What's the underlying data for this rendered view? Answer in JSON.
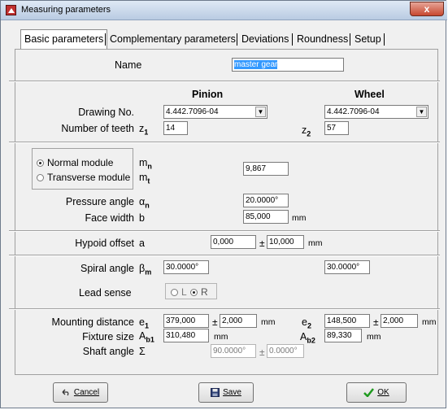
{
  "window": {
    "title": "Measuring parameters",
    "close_label": "x"
  },
  "tabs": [
    {
      "label": "Basic parameters",
      "active": true
    },
    {
      "label": "Complementary parameters",
      "active": false
    },
    {
      "label": "Deviations",
      "active": false
    },
    {
      "label": "Roundness",
      "active": false
    },
    {
      "label": "Setup",
      "active": false
    }
  ],
  "name": {
    "label": "Name",
    "value": "master gear"
  },
  "columns": {
    "pinion": "Pinion",
    "wheel": "Wheel"
  },
  "drawing": {
    "label": "Drawing No.",
    "pinion": "4.442.7096-04",
    "wheel": "4.442.7096-04"
  },
  "teeth": {
    "label": "Number of teeth",
    "sym_pinion": "z",
    "sub_pinion": "1",
    "pinion": "14",
    "sym_wheel": "z",
    "sub_wheel": "2",
    "wheel": "57"
  },
  "module": {
    "normal_label": "Normal module",
    "transverse_label": "Transverse module",
    "selected": "normal",
    "sym_normal": "m",
    "sub_normal": "n",
    "sym_trans": "m",
    "sub_trans": "t",
    "value": "9,867"
  },
  "pressure": {
    "label": "Pressure angle",
    "sym": "α",
    "sub": "n",
    "value": "20.0000°"
  },
  "face": {
    "label": "Face width",
    "sym": "b",
    "value": "85,000",
    "unit": "mm"
  },
  "hypoid": {
    "label": "Hypoid offset",
    "sym": "a",
    "value": "0,000",
    "pm": "±",
    "tol": "10,000",
    "unit": "mm"
  },
  "spiral": {
    "label": "Spiral angle",
    "sym": "β",
    "sub": "m",
    "pinion": "30.0000°",
    "wheel": "30.0000°"
  },
  "lead": {
    "label": "Lead sense",
    "opt_l": "L",
    "opt_r": "R",
    "selected": "R"
  },
  "mounting": {
    "label": "Mounting distance",
    "sym1": "e",
    "sub1": "1",
    "p_value": "379,000",
    "pm": "±",
    "p_tol": "2,000",
    "unit": "mm",
    "sym2": "e",
    "sub2": "2",
    "w_value": "148,500",
    "w_tol": "2,000"
  },
  "fixture": {
    "label": "Fixture size",
    "sym1": "A",
    "sub1": "b1",
    "p_value": "310,480",
    "unit": "mm",
    "sym2": "A",
    "sub2": "b2",
    "w_value": "89,330"
  },
  "shaft": {
    "label": "Shaft angle",
    "sym": "Σ",
    "value": "90.0000°",
    "pm": "±",
    "tol": "0.0000°"
  },
  "buttons": {
    "cancel": "Cancel",
    "save": "Save",
    "ok": "OK"
  },
  "colors": {
    "title_gradient": "#c8d8ec",
    "close": "#c7472f",
    "ok_check": "#1f9a1f",
    "selection": "#3399ff"
  }
}
